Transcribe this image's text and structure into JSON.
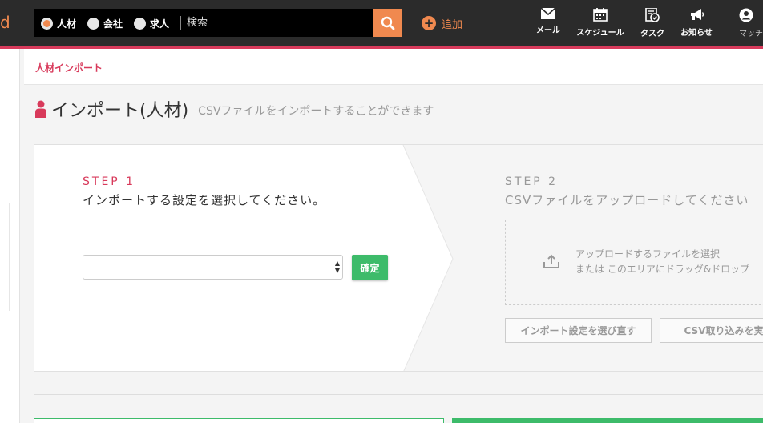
{
  "header": {
    "logo_letter": "d",
    "search": {
      "radios": [
        {
          "label": "人材",
          "selected": true
        },
        {
          "label": "会社",
          "selected": false
        },
        {
          "label": "求人",
          "selected": false
        }
      ],
      "placeholder": "検索"
    },
    "add_label": "追加",
    "nav": [
      {
        "label": "メール",
        "icon": "mail-icon"
      },
      {
        "label": "スケジュール",
        "icon": "calendar-icon"
      },
      {
        "label": "タスク",
        "icon": "task-icon"
      },
      {
        "label": "お知らせ",
        "icon": "megaphone-icon"
      },
      {
        "label": "マッチ",
        "icon": "user-circle-icon"
      }
    ],
    "accent_color": "#d83a5b",
    "brand_color": "#f0894f"
  },
  "breadcrumb": "人材インポート",
  "page": {
    "title": "インポート(人材)",
    "subtitle": "CSVファイルをインポートすることができます"
  },
  "step1": {
    "label": "STEP 1",
    "description": "インポートする設定を選択してください。",
    "select_value": "",
    "confirm_label": "確定"
  },
  "step2": {
    "label": "STEP 2",
    "description": "CSVファイルをアップロードしてください",
    "dropzone_line1": "アップロードするファイルを選択",
    "dropzone_line2": "または このエリアにドラッグ&ドロップ",
    "reselect_label": "インポート設定を選び直す",
    "csv_import_label": "CSV取り込みを実"
  }
}
